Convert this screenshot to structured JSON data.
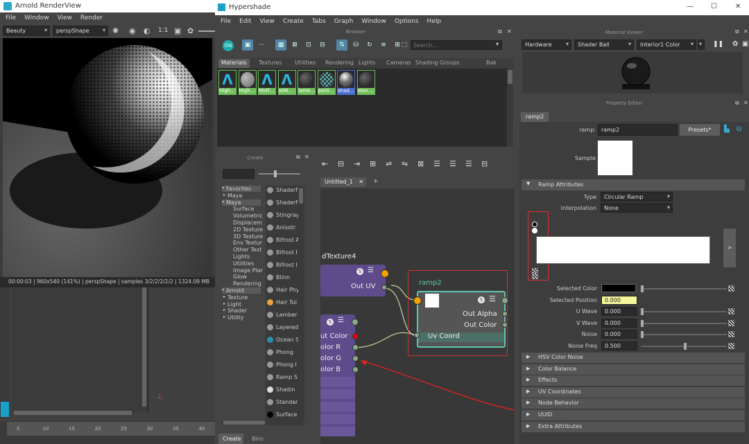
{
  "renderview": {
    "title": "Arnold RenderView",
    "menus": [
      "File",
      "Window",
      "View",
      "Render"
    ],
    "aov": "Beauty",
    "camera": "perspShape",
    "zoom_label": "1:1",
    "status": "00:00:03 | 960x540 (141%) | perspShape | samples 3/2/2/2/2/2 | 1324.09 MB"
  },
  "timeline": {
    "ticks": [
      "5",
      "10",
      "15",
      "20",
      "25",
      "30",
      "35",
      "40"
    ]
  },
  "hypershade": {
    "title": "Hypershade",
    "window_controls": [
      "—",
      "☐",
      "✕"
    ],
    "menus": [
      "File",
      "Edit",
      "View",
      "Create",
      "Tabs",
      "Graph",
      "Window",
      "Options",
      "Help"
    ],
    "browser_header": "Browser",
    "search_placeholder": "Search...",
    "browser_tabs": [
      "Materials",
      "Textures",
      "Utilities",
      "Rendering",
      "Lights",
      "Cameras",
      "Shading Groups",
      "Bak"
    ],
    "swatches": [
      {
        "label": "High...",
        "icon": "arnold-a-icon"
      },
      {
        "label": "High...",
        "icon": "gray-sphere-icon"
      },
      {
        "label": "MidT...",
        "icon": "arnold-a-icon"
      },
      {
        "label": "aiMi...",
        "icon": "arnold-a-icon"
      },
      {
        "label": "lamb...",
        "icon": "dark-sphere-icon"
      },
      {
        "label": "parti...",
        "icon": "checker-sphere-icon"
      },
      {
        "label": "shad...",
        "icon": "shiny-sphere-icon"
      },
      {
        "label": "stan...",
        "icon": "dark-sphere-icon"
      }
    ],
    "create_header": "Create",
    "create_tree": [
      {
        "label": "Favorites",
        "header": true
      },
      {
        "label": "Maya",
        "indent": 1
      },
      {
        "label": "Maya",
        "header": true
      },
      {
        "label": "Surface",
        "indent": 2
      },
      {
        "label": "Volumetric",
        "indent": 2
      },
      {
        "label": "Displacem",
        "indent": 2
      },
      {
        "label": "2D Texture",
        "indent": 2
      },
      {
        "label": "3D Texture",
        "indent": 2
      },
      {
        "label": "Env Textur",
        "indent": 2
      },
      {
        "label": "Other Text",
        "indent": 2
      },
      {
        "label": "Lights",
        "indent": 2
      },
      {
        "label": "Utilities",
        "indent": 2
      },
      {
        "label": "Image Plar",
        "indent": 2
      },
      {
        "label": "Glow",
        "indent": 2
      },
      {
        "label": "Rendering",
        "indent": 2
      },
      {
        "label": "Arnold",
        "header": true
      },
      {
        "label": "Texture",
        "indent": 1
      },
      {
        "label": "Light",
        "indent": 1
      },
      {
        "label": "Shader",
        "indent": 1
      },
      {
        "label": "Utility",
        "indent": 1
      }
    ],
    "create_nodes": [
      "Shaderf",
      "Shaderf",
      "Stingray",
      "Anisotr",
      "Bifrost A",
      "Bifrost I",
      "Bifrost I",
      "Blinn",
      "Hair Phy",
      "Hair Tul",
      "Lamber",
      "Layered",
      "Ocean S",
      "Phong",
      "Phong I",
      "Ramp S",
      "Shadin",
      "Standar",
      "Surface"
    ],
    "bottom_tabs": [
      "Create",
      "Bins"
    ],
    "graph_tab": "Untitled_1",
    "graph_tab_add": "+",
    "node_dtexture": {
      "title": "dTexture4",
      "out": "Out UV"
    },
    "node_ramp": {
      "title": "ramp2",
      "outputs": [
        "Out Alpha",
        "Out Color"
      ],
      "input": "Uv Coord"
    },
    "node_left": {
      "attrs": [
        "ut Color",
        "olor R",
        "olor G",
        "olor B"
      ]
    }
  },
  "material_viewer": {
    "header": "Material Viewer",
    "renderer": "Hardware",
    "geometry": "Shader Ball",
    "environment": "Interior1 Color"
  },
  "property_editor": {
    "header": "Property Editor",
    "tab": "ramp2",
    "node_label": "ramp:",
    "node_name": "ramp2",
    "presets": "Presets*",
    "sample_label": "Sample",
    "ramp_section": "Ramp Attributes",
    "type_label": "Type",
    "type_value": "Circular Ramp",
    "interp_label": "Interpolation",
    "interp_value": "None",
    "expand_btn": ">",
    "attrs": [
      {
        "label": "Selected Color",
        "value": "",
        "kind": "color"
      },
      {
        "label": "Selected Position",
        "value": "0.000",
        "kind": "highlight"
      },
      {
        "label": "U Wave",
        "value": "0.000",
        "kind": "num",
        "slider": 0.0
      },
      {
        "label": "V Wave",
        "value": "0.000",
        "kind": "num",
        "slider": 0.0
      },
      {
        "label": "Noise",
        "value": "0.000",
        "kind": "num",
        "slider": 0.0
      },
      {
        "label": "Noise Freq",
        "value": "0.500",
        "kind": "num",
        "slider": 0.5
      }
    ],
    "sections": [
      "HSV Color Noise",
      "Color Balance",
      "Effects",
      "UV Coordinates",
      "Node Behavior",
      "UUID",
      "Extra Attributes"
    ]
  }
}
